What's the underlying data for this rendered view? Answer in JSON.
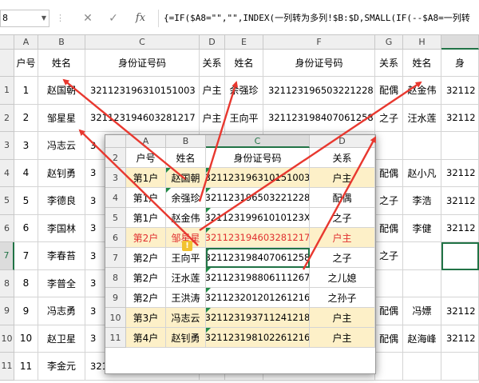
{
  "formula_bar": {
    "name_box": "8",
    "cancel_glyph": "✕",
    "enter_glyph": "✓",
    "fx_glyph": "fx",
    "formula": "{=IF($A8=\"\",\"\",INDEX(一列转为多列!$B:$D,SMALL(IF(--$A8=一列转"
  },
  "main_sheet": {
    "columns": [
      "A",
      "B",
      "C",
      "D",
      "E",
      "F",
      "G",
      "H",
      ""
    ],
    "header_row": [
      "户号",
      "姓名",
      "身份证号码",
      "关系",
      "姓名",
      "身份证号码",
      "关系",
      "姓名",
      "身"
    ],
    "rows": [
      {
        "num": "1",
        "a": "1",
        "b": "赵国朝",
        "c": "321123196310151003",
        "d": "户主",
        "e": "余强珍",
        "f": "321123196503221228",
        "g": "配偶",
        "h": "赵金伟",
        "i": "32112"
      },
      {
        "num": "2",
        "a": "2",
        "b": "邹星星",
        "c": "321123194603281217",
        "d": "户主",
        "e": "王向平",
        "f": "321123198407061258",
        "g": "之子",
        "h": "汪水莲",
        "i": "32112"
      },
      {
        "num": "3",
        "a": "3",
        "b": "冯志云",
        "c": "3",
        "d": "",
        "e": "",
        "f": "",
        "g": "",
        "h": "",
        "i": ""
      },
      {
        "num": "4",
        "a": "4",
        "b": "赵钊勇",
        "c": "3",
        "d": "",
        "e": "",
        "f": "",
        "g": "配偶",
        "h": "赵小凡",
        "i": "32112"
      },
      {
        "num": "5",
        "a": "5",
        "b": "李德良",
        "c": "3",
        "d": "",
        "e": "",
        "f": "",
        "g": "之子",
        "h": "李浩",
        "i": "32112"
      },
      {
        "num": "6",
        "a": "6",
        "b": "李国林",
        "c": "3",
        "d": "",
        "e": "",
        "f": "",
        "g": "配偶",
        "h": "李健",
        "i": "32112"
      },
      {
        "num": "7",
        "a": "7",
        "b": "李春苔",
        "c": "3",
        "d": "",
        "e": "",
        "f": "",
        "g": "之子",
        "h": "",
        "i": ""
      },
      {
        "num": "8",
        "a": "8",
        "b": "李普全",
        "c": "3",
        "d": "",
        "e": "",
        "f": "",
        "g": "",
        "h": "",
        "i": ""
      },
      {
        "num": "9",
        "a": "9",
        "b": "冯志勇",
        "c": "3",
        "d": "",
        "e": "",
        "f": "",
        "g": "配偶",
        "h": "冯嫖",
        "i": "32112"
      },
      {
        "num": "10",
        "a": "10",
        "b": "赵卫星",
        "c": "3",
        "d": "",
        "e": "",
        "f": "",
        "g": "配偶",
        "h": "赵海峰",
        "i": "32112"
      },
      {
        "num": "11",
        "a": "11",
        "b": "李金元",
        "c": "3211231",
        "d": "",
        "e": "",
        "f": "",
        "g": "",
        "h": "",
        "i": ""
      }
    ]
  },
  "source_sheet": {
    "columns": [
      "A",
      "B",
      "C",
      "D"
    ],
    "header_row": {
      "num": "2",
      "a": "户号",
      "b": "姓名",
      "c": "身份证号码",
      "d": "关系"
    },
    "rows": [
      {
        "num": "3",
        "a": "第1户",
        "b": "赵国朝",
        "c": "321123196310151003",
        "d": "户主"
      },
      {
        "num": "4",
        "a": "第1户",
        "b": "余强珍",
        "c": "321123196503221228",
        "d": "配偶"
      },
      {
        "num": "5",
        "a": "第1户",
        "b": "赵金伟",
        "c": "32112319961010123X",
        "d": "之子"
      },
      {
        "num": "6",
        "a": "第2户",
        "b": "邹星星",
        "c": "321123194603281217",
        "d": "户主"
      },
      {
        "num": "7",
        "a": "第2户",
        "b": "王向平",
        "c": "321123198407061258",
        "d": "之子"
      },
      {
        "num": "8",
        "a": "第2户",
        "b": "汪水莲",
        "c": "321123198806111267",
        "d": "之儿媳"
      },
      {
        "num": "9",
        "a": "第2户",
        "b": "王洪涛",
        "c": "321123201201261216",
        "d": "之孙子"
      },
      {
        "num": "10",
        "a": "第3户",
        "b": "冯志云",
        "c": "321123193711241218",
        "d": "户主"
      },
      {
        "num": "11",
        "a": "第4户",
        "b": "赵钊勇",
        "c": "321123198102261216",
        "d": "户主"
      }
    ],
    "warning_glyph": "!"
  },
  "colors": {
    "excel_green": "#217346",
    "highlight_yellow": "#fdf0c8",
    "red_text": "#e03030",
    "arrow_red": "#e8382f"
  }
}
